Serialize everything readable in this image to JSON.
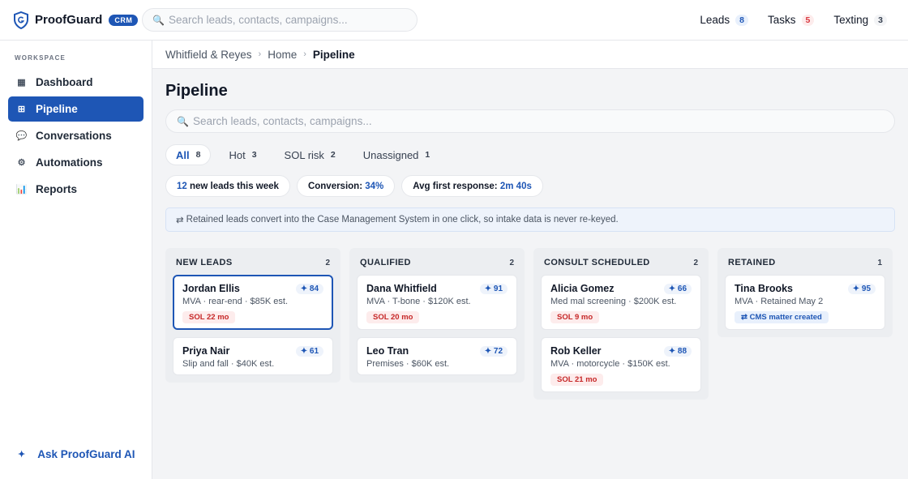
{
  "app": {
    "name": "ProofGuard",
    "tag": "CRM",
    "search_placeholder": "Search leads, contacts, campaigns...",
    "nav": [
      {
        "label": "Leads",
        "count": "8",
        "tone": "blue"
      },
      {
        "label": "Tasks",
        "count": "5",
        "tone": "red"
      },
      {
        "label": "Texting",
        "count": "3",
        "tone": "gray"
      }
    ]
  },
  "sidebar": {
    "section": "WORKSPACE",
    "items": [
      {
        "label": "Dashboard",
        "icon": "grid-icon"
      },
      {
        "label": "Pipeline",
        "icon": "board-icon"
      },
      {
        "label": "Conversations",
        "icon": "chat-icon"
      },
      {
        "label": "Automations",
        "icon": "gear-icon"
      },
      {
        "label": "Reports",
        "icon": "bar-chart-icon"
      }
    ],
    "ask_ai": "Ask ProofGuard AI"
  },
  "breadcrumb": [
    "Whitfield & Reyes",
    "Home",
    "Pipeline"
  ],
  "page": {
    "title": "Pipeline",
    "search_placeholder": "Search leads, contacts, campaigns...",
    "filters": [
      {
        "label": "All",
        "count": "8"
      },
      {
        "label": "Hot",
        "count": "3"
      },
      {
        "label": "SOL risk",
        "count": "2"
      },
      {
        "label": "Unassigned",
        "count": "1"
      }
    ],
    "stats": {
      "new_leads_value": "12",
      "new_leads_label": "new leads this week",
      "conversion_label": "Conversion:",
      "conversion_value": "34%",
      "response_label": "Avg first response:",
      "response_value": "2m 40s"
    },
    "info": "Retained leads convert into the Case Management System in one click, so intake data is never re-keyed."
  },
  "board": {
    "columns": [
      {
        "title": "NEW LEADS",
        "count": "2",
        "cards": [
          {
            "name": "Jordan Ellis",
            "score": "✦ 84",
            "meta": "MVA · rear-end · $85K est.",
            "tag": "SOL 22 mo"
          },
          {
            "name": "Priya Nair",
            "score": "✦ 61",
            "meta": "Slip and fall · $40K est."
          }
        ]
      },
      {
        "title": "QUALIFIED",
        "count": "2",
        "cards": [
          {
            "name": "Dana Whitfield",
            "score": "✦ 91",
            "meta": "MVA · T-bone · $120K est.",
            "tag": "SOL 20 mo"
          },
          {
            "name": "Leo Tran",
            "score": "✦ 72",
            "meta": "Premises · $60K est."
          }
        ]
      },
      {
        "title": "CONSULT SCHEDULED",
        "count": "2",
        "cards": [
          {
            "name": "Alicia Gomez",
            "score": "✦ 66",
            "meta": "Med mal screening · $200K est.",
            "tag": "SOL 9 mo"
          },
          {
            "name": "Rob Keller",
            "score": "✦ 88",
            "meta": "MVA · motorcycle · $150K est.",
            "tag": "SOL 21 mo"
          }
        ]
      },
      {
        "title": "RETAINED",
        "count": "1",
        "cards": [
          {
            "name": "Tina Brooks",
            "score": "✦ 95",
            "meta": "MVA · Retained May 2",
            "tag": "⇄ CMS matter created"
          }
        ]
      }
    ]
  }
}
